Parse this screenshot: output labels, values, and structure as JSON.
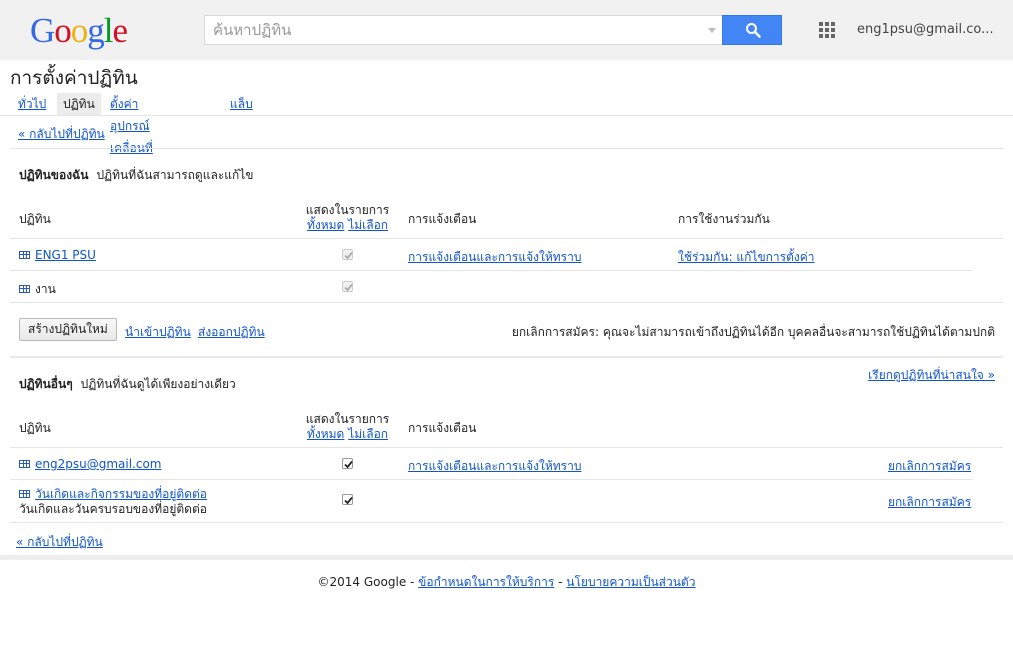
{
  "header": {
    "logo_letters": [
      {
        "ch": "G",
        "color": "#3369e8"
      },
      {
        "ch": "o",
        "color": "#d50f25"
      },
      {
        "ch": "o",
        "color": "#eeb211"
      },
      {
        "ch": "g",
        "color": "#3369e8"
      },
      {
        "ch": "l",
        "color": "#009925"
      },
      {
        "ch": "e",
        "color": "#d50f25"
      }
    ],
    "search_placeholder": "ค้นหาปฏิทิน",
    "search_icon": "search-icon",
    "apps_icon": "apps-grid-icon",
    "account": "eng1psu@gmail.co..."
  },
  "page": {
    "title": "การตั้งค่าปฏิทิน",
    "tabs": [
      {
        "label": "ทั่วไป",
        "active": false
      },
      {
        "label": "ปฏิทิน",
        "active": true
      },
      {
        "label": "ตั้งค่าอุปกรณ์เคลื่อนที่",
        "active": false
      },
      {
        "label": "แล็บ",
        "active": false
      }
    ],
    "back_link": "« กลับไปที่ปฏิทิน"
  },
  "my_calendars": {
    "title": "ปฏิทินของฉัน",
    "subtitle": "ปฏิทินที่ฉันสามารถดูและแก้ไข",
    "col_calendar": "ปฏิทิน",
    "col_show_label": "แสดงในรายการ",
    "col_show_all": "ทั้งหมด",
    "col_show_none": "ไม่เลือก",
    "col_notifications": "การแจ้งเตือน",
    "col_sharing": "การใช้งานร่วมกัน",
    "rows": [
      {
        "name": "ENG1 PSU",
        "linked": true,
        "checked": true,
        "notifications": "การแจ้งเตือนและการแจ้งให้ทราบ",
        "sharing": "ใช้ร่วมกัน: แก้ไขการตั้งค่า"
      },
      {
        "name": "งาน",
        "linked": false,
        "checked": true,
        "notifications": "",
        "sharing": ""
      }
    ],
    "create_button": "สร้างปฏิทินใหม่",
    "import_link": "นำเข้าปฏิทิน",
    "export_link": "ส่งออกปฏิทิน",
    "unsubscribe_note": "ยกเลิกการสมัคร: คุณจะไม่สามารถเข้าถึงปฏิทินได้อีก บุคคลอื่นจะสามารถใช้ปฏิทินได้ตามปกติ"
  },
  "other_calendars": {
    "title": "ปฏิทินอื่นๆ",
    "subtitle": "ปฏิทินที่ฉันดูได้เพียงอย่างเดียว",
    "browse_link": "เรียกดูปฏิทินที่น่าสนใจ »",
    "col_calendar": "ปฏิทิน",
    "col_show_label": "แสดงในรายการ",
    "col_show_all": "ทั้งหมด",
    "col_show_none": "ไม่เลือก",
    "col_notifications": "การแจ้งเตือน",
    "rows": [
      {
        "name": "eng2psu@gmail.com",
        "sub": "",
        "checked": true,
        "notifications": "การแจ้งเตือนและการแจ้งให้ทราบ",
        "action": "ยกเลิกการสมัคร"
      },
      {
        "name": "วันเกิดและกิจกรรมของที่อยู่ติดต่อ",
        "sub": "วันเกิดและวันครบรอบของที่อยู่ติดต่อ",
        "checked": true,
        "notifications": "",
        "action": "ยกเลิกการสมัคร"
      }
    ]
  },
  "footer": {
    "copyright": "©2014 Google",
    "sep1": " - ",
    "terms": "ข้อกำหนดในการให้บริการ",
    "sep2": " - ",
    "privacy": "นโยบายความเป็นส่วนตัว"
  }
}
